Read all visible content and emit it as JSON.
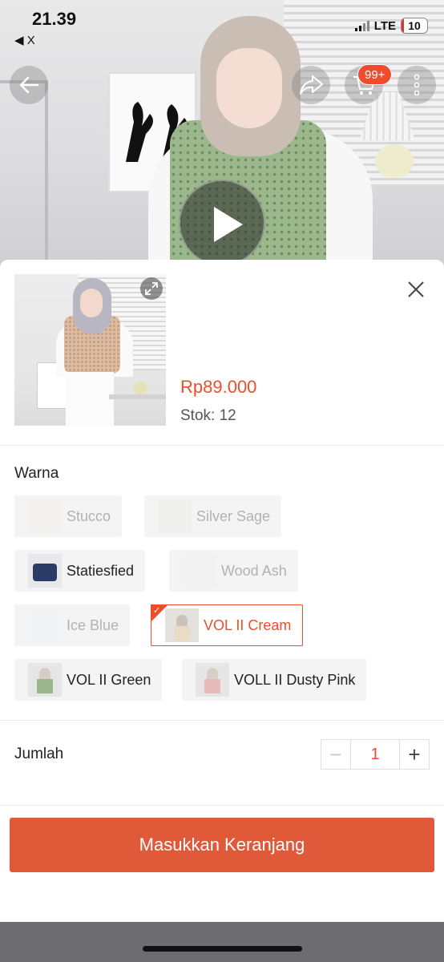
{
  "status_bar": {
    "time": "21.39",
    "back_app": "◀ X",
    "network": "LTE",
    "battery": "10"
  },
  "top_actions": {
    "cart_badge": "99+"
  },
  "product": {
    "price": "Rp89.000",
    "stock": "Stok: 12"
  },
  "variant_section": {
    "title": "Warna",
    "options": [
      {
        "label": "Stucco",
        "state": "disabled"
      },
      {
        "label": "Silver Sage",
        "state": "disabled"
      },
      {
        "label": "Statiesfied",
        "state": "available"
      },
      {
        "label": "Wood Ash",
        "state": "disabled"
      },
      {
        "label": "Ice Blue",
        "state": "disabled"
      },
      {
        "label": "VOL II Cream",
        "state": "selected"
      },
      {
        "label": "VOL II Green",
        "state": "available"
      },
      {
        "label": "VOLL II Dusty Pink",
        "state": "available"
      }
    ]
  },
  "quantity": {
    "label": "Jumlah",
    "value": "1",
    "minus": "−",
    "plus": "+"
  },
  "cta": {
    "label": "Masukkan Keranjang"
  },
  "colors": {
    "accent": "#ee4d2d",
    "cta_bg": "#e05a3a"
  }
}
